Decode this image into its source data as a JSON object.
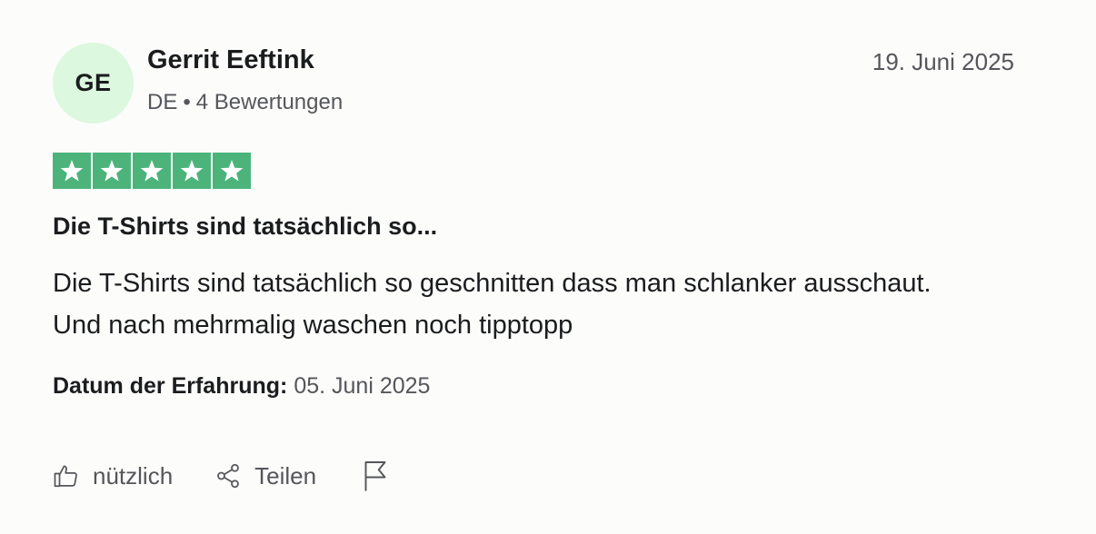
{
  "reviewer": {
    "initials": "GE",
    "name": "Gerrit Eeftink",
    "country": "DE",
    "separator": "•",
    "reviews_count": "4 Bewertungen"
  },
  "review_date": "19. Juni 2025",
  "rating": {
    "value": 5,
    "max": 5,
    "color": "#4cb47b"
  },
  "review": {
    "title": "Die T-Shirts sind tatsächlich so...",
    "body": "Die T-Shirts sind tatsächlich so geschnitten dass man schlanker ausschaut. Und nach mehrmalig waschen noch tipptopp"
  },
  "experience": {
    "label": "Datum der Erfahrung:",
    "value": "05. Juni 2025"
  },
  "actions": {
    "useful_label": "nützlich",
    "useful_icon": "thumbs-up-icon",
    "share_label": "Teilen",
    "share_icon": "share-icon",
    "report_icon": "flag-icon"
  },
  "colors": {
    "avatar_bg": "#dcf8de",
    "star_green": "#4cb47b",
    "muted_text": "#55565a"
  }
}
